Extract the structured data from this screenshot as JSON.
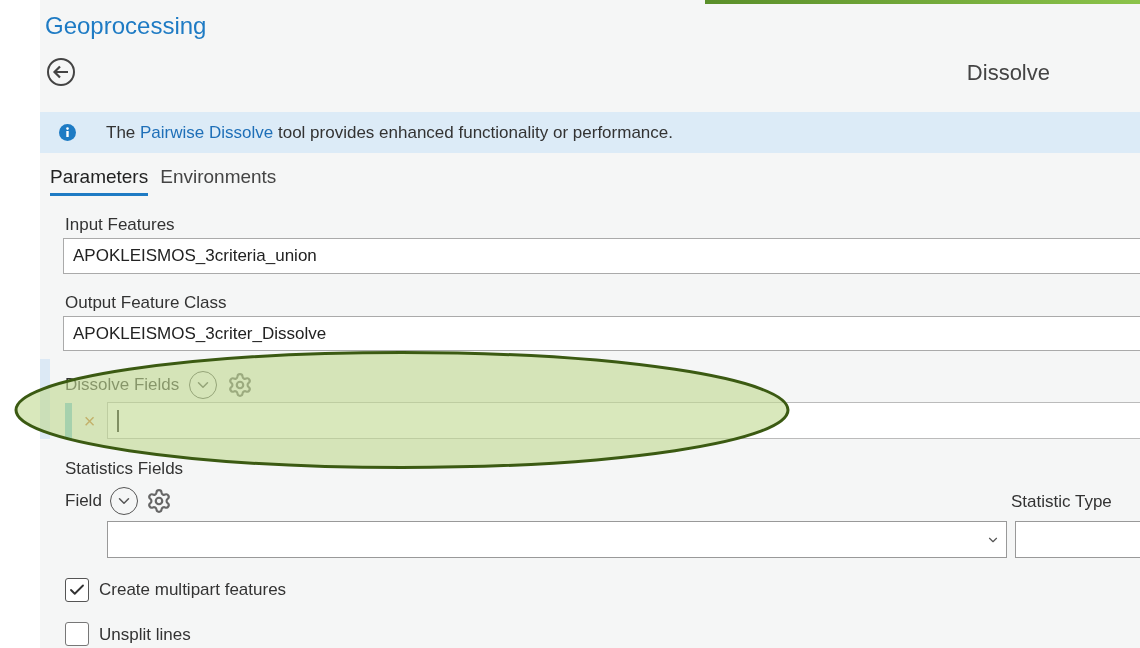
{
  "header": {
    "title": "Geoprocessing",
    "tool_name": "Dissolve"
  },
  "info_banner": {
    "text_before": "The ",
    "link": "Pairwise Dissolve",
    "text_after": " tool provides enhanced functionality or performance."
  },
  "tabs": [
    {
      "label": "Parameters",
      "selected": true
    },
    {
      "label": "Environments",
      "selected": false
    }
  ],
  "input_features": {
    "label": "Input Features",
    "value": "APOKLEISMOS_3criteria_union"
  },
  "output_feature_class": {
    "label": "Output Feature Class",
    "value": "APOKLEISMOS_3criter_Dissolve"
  },
  "dissolve_fields": {
    "label": "Dissolve Fields",
    "remove_glyph": "×"
  },
  "statistics_fields": {
    "label": "Statistics Fields",
    "field_label": "Field",
    "statistic_type_label": "Statistic Type"
  },
  "options": [
    {
      "label": "Create multipart features",
      "checked": true
    },
    {
      "label": "Unsplit lines",
      "checked": false
    }
  ]
}
